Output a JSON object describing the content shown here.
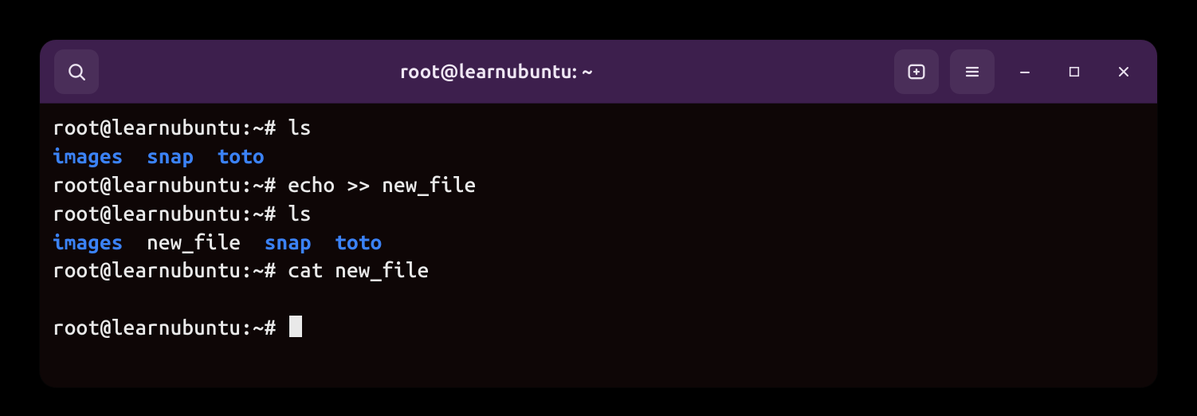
{
  "colors": {
    "titlebar": "#3d1f4d",
    "terminal_bg": "#0e0606",
    "fg": "#e9e9e9",
    "dir": "#3b82f6"
  },
  "titlebar": {
    "title": "root@learnubuntu: ~"
  },
  "prompt_prefix": "root@learnubuntu:~# ",
  "terminal": {
    "lines": [
      {
        "prompt": "root@learnubuntu:~# ",
        "cmd": "ls"
      },
      {
        "listing": [
          "images",
          "snap",
          "toto"
        ],
        "plain_indices": []
      },
      {
        "prompt": "root@learnubuntu:~# ",
        "cmd": "echo >> new_file"
      },
      {
        "prompt": "root@learnubuntu:~# ",
        "cmd": "ls"
      },
      {
        "listing": [
          "images",
          "new_file",
          "snap",
          "toto"
        ],
        "plain_indices": [
          1
        ]
      },
      {
        "prompt": "root@learnubuntu:~# ",
        "cmd": "cat new_file"
      },
      {
        "blank": true
      },
      {
        "prompt": "root@learnubuntu:~# ",
        "cursor": true
      }
    ]
  }
}
